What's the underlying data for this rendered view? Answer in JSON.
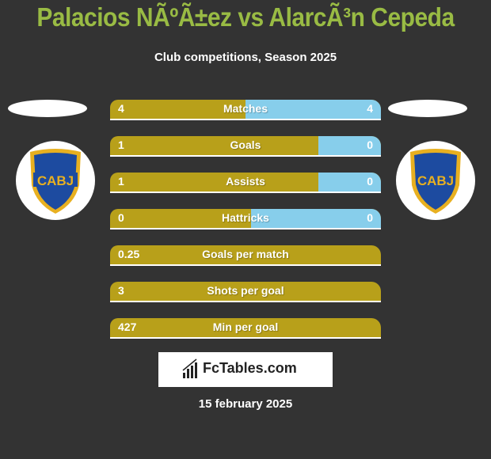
{
  "header": {
    "title": "Palacios NÃºÃ±ez vs AlarcÃ³n Cepeda",
    "subtitle": "Club competitions, Season 2025"
  },
  "left_team": {
    "logo_text": "CABJ",
    "logo_icon": "boca-juniors-crest-icon"
  },
  "right_team": {
    "logo_text": "CABJ",
    "logo_icon": "boca-juniors-crest-icon"
  },
  "colors": {
    "left_bar": "#b8a01a",
    "right_bar": "#87ceeb",
    "title": "#99bb44",
    "background": "#333333"
  },
  "stats": [
    {
      "label": "Matches",
      "left": "4",
      "right": "4",
      "left_share": 0.5
    },
    {
      "label": "Goals",
      "left": "1",
      "right": "0",
      "left_share": 0.77
    },
    {
      "label": "Assists",
      "left": "1",
      "right": "0",
      "left_share": 0.77
    },
    {
      "label": "Hattricks",
      "left": "0",
      "right": "0",
      "left_share": 0.52
    },
    {
      "label": "Goals per match",
      "left": "0.25",
      "right": "",
      "left_share": 1.0
    },
    {
      "label": "Shots per goal",
      "left": "3",
      "right": "",
      "left_share": 1.0
    },
    {
      "label": "Min per goal",
      "left": "427",
      "right": "",
      "left_share": 1.0
    }
  ],
  "brand": {
    "name": "FcTables.com",
    "icon": "bar-chart-icon"
  },
  "footer": {
    "date": "15 february 2025"
  }
}
